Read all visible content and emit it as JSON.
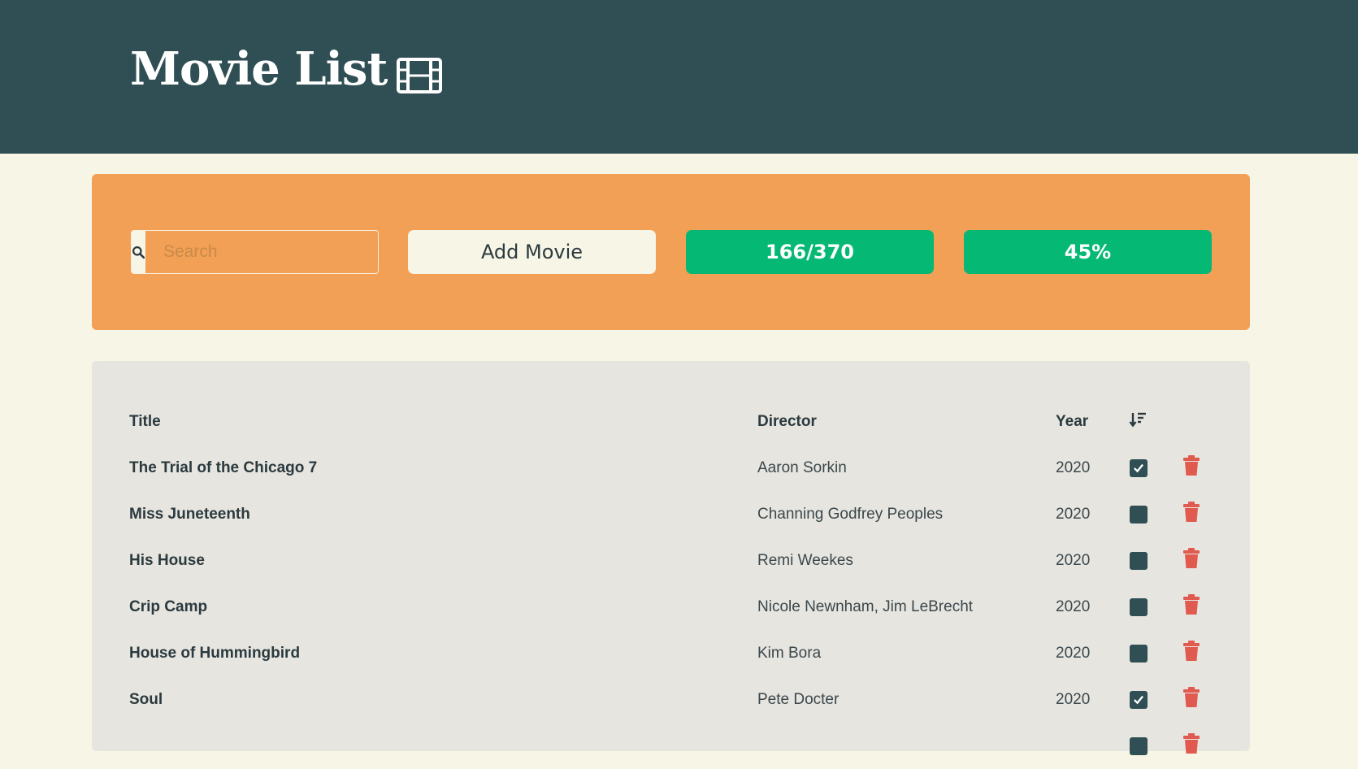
{
  "header": {
    "title": "Movie List",
    "icon": "film-icon"
  },
  "toolbar": {
    "search_placeholder": "Search",
    "search_icon": "search-icon",
    "add_label": "Add Movie",
    "count": "166/370",
    "percent": "45%"
  },
  "table": {
    "headers": {
      "title": "Title",
      "director": "Director",
      "year": "Year",
      "sort_icon": "sort-icon"
    },
    "rows": [
      {
        "title": "The Trial of the Chicago 7",
        "director": "Aaron Sorkin",
        "year": "2020",
        "watched": true
      },
      {
        "title": "Miss Juneteenth",
        "director": "Channing Godfrey Peoples",
        "year": "2020",
        "watched": false
      },
      {
        "title": "His House",
        "director": "Remi Weekes",
        "year": "2020",
        "watched": false
      },
      {
        "title": "Crip Camp",
        "director": "Nicole Newnham, Jim LeBrecht",
        "year": "2020",
        "watched": false
      },
      {
        "title": "House of Hummingbird",
        "director": "Kim Bora",
        "year": "2020",
        "watched": false
      },
      {
        "title": "Soul",
        "director": "Pete Docter",
        "year": "2020",
        "watched": true
      }
    ]
  },
  "colors": {
    "header_bg": "#2f4f54",
    "toolbar_bg": "#f2a055",
    "stat_bg": "#05b874",
    "delete": "#e05a4f",
    "checkbox": "#2f4f54"
  }
}
